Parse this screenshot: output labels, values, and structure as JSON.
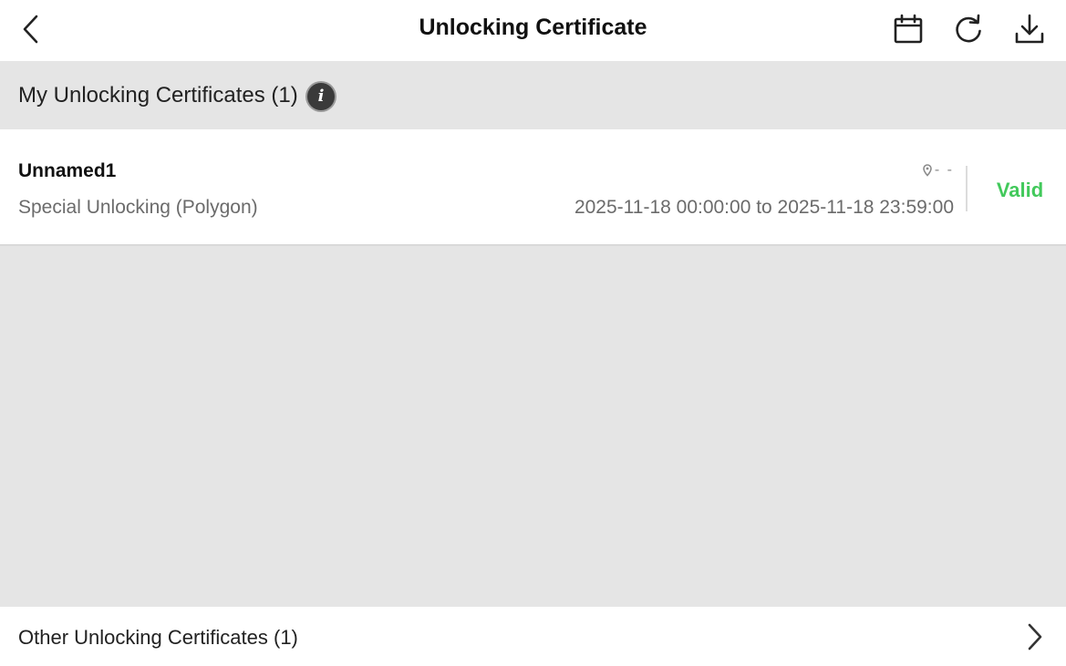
{
  "header": {
    "title": "Unlocking Certificate",
    "back_icon": "chevron-left-icon",
    "actions": [
      {
        "icon": "calendar-icon"
      },
      {
        "icon": "refresh-icon"
      },
      {
        "icon": "download-icon"
      }
    ]
  },
  "section": {
    "title": "My Unlocking Certificates (1)",
    "info_icon": "info-icon",
    "info_glyph": "i"
  },
  "certificates": [
    {
      "name": "Unnamed1",
      "type": "Special Unlocking (Polygon)",
      "location": "- -",
      "location_icon": "location-pin-icon",
      "time_range": "2025-11-18 00:00:00 to 2025-11-18 23:59:00",
      "status": "Valid",
      "status_color": "#42c95b"
    }
  ],
  "other": {
    "label": "Other Unlocking Certificates (1)",
    "icon": "chevron-right-icon"
  }
}
